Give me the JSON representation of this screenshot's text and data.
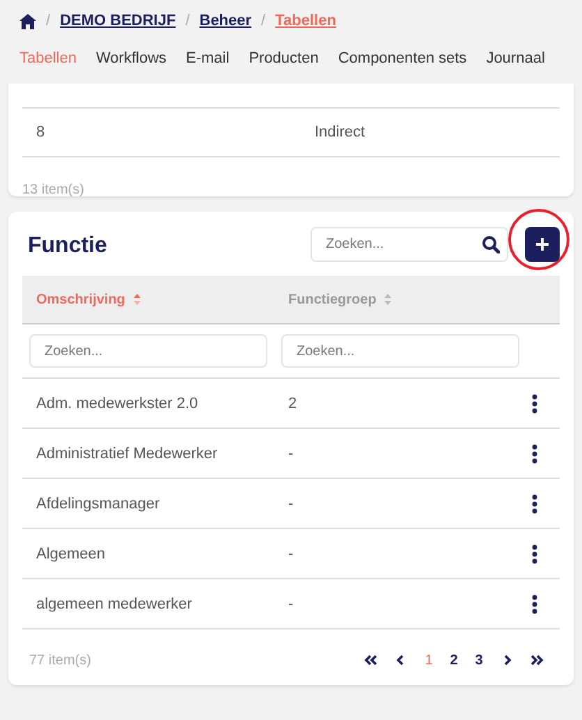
{
  "breadcrumb": [
    {
      "separator": "/",
      "label": "DEMO BEDRIJF",
      "current": false
    },
    {
      "separator": "/",
      "label": "Beheer",
      "current": false
    },
    {
      "separator": "/",
      "label": "Tabellen",
      "current": true
    }
  ],
  "tabs": [
    {
      "label": "Tabellen",
      "selected": true
    },
    {
      "label": "Workflows",
      "selected": false
    },
    {
      "label": "E-mail",
      "selected": false
    },
    {
      "label": "Producten",
      "selected": false
    },
    {
      "label": "Componenten sets",
      "selected": false
    },
    {
      "label": "Journaal",
      "selected": false
    }
  ],
  "previous_table": {
    "rows": [
      [
        "8",
        "Indirect"
      ]
    ],
    "count": "13 item(s)"
  },
  "functie": {
    "title": "Functie",
    "search": {
      "placeholder": "Zoeken..."
    },
    "columns": [
      {
        "label": "Omschrijving",
        "sorted": true
      },
      {
        "label": "Functiegroep",
        "sorted": false
      }
    ],
    "filters": [
      {
        "placeholder": "Zoeken..."
      },
      {
        "placeholder": "Zoeken..."
      }
    ],
    "rows": [
      {
        "omschrijving": "Adm. medewerkster 2.0",
        "functiegroep": "2"
      },
      {
        "omschrijving": "Administratief Medewerker",
        "functiegroep": "-"
      },
      {
        "omschrijving": "Afdelingsmanager",
        "functiegroep": "-"
      },
      {
        "omschrijving": "Algemeen",
        "functiegroep": "-"
      },
      {
        "omschrijving": "algemeen medewerker",
        "functiegroep": "-"
      }
    ],
    "count": "77 item(s)",
    "pages": [
      {
        "label": "1",
        "selected": true
      },
      {
        "label": "2",
        "selected": false
      },
      {
        "label": "3",
        "selected": false
      }
    ]
  }
}
